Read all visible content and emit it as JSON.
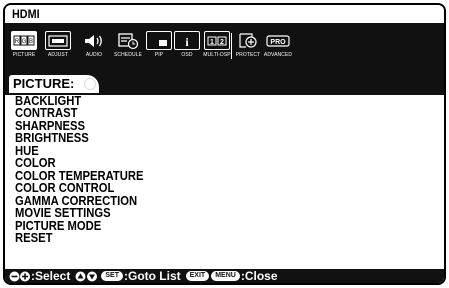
{
  "header": {
    "title": "HDMI"
  },
  "tabs": [
    {
      "label": "PICTURE",
      "icon": "picture-rgb-icon",
      "active": true
    },
    {
      "label": "ADJUST",
      "icon": "adjust-icon"
    },
    {
      "label": "AUDIO",
      "icon": "speaker-icon"
    },
    {
      "label": "SCHEDULE",
      "icon": "schedule-icon"
    },
    {
      "label": "PIP",
      "icon": "pip-icon"
    },
    {
      "label": "OSD",
      "icon": "info-icon"
    },
    {
      "label": "MULTI-DSP",
      "icon": "multi-display-icon"
    },
    {
      "label": "PROTECT",
      "icon": "protect-icon"
    },
    {
      "label": "ADVANCED",
      "icon": "pro-icon"
    }
  ],
  "icon_text": {
    "rgb": [
      "R",
      "G",
      "B"
    ],
    "osd": "i",
    "multi": [
      "1",
      "2"
    ],
    "pro": "PRO"
  },
  "section": {
    "title": "PICTURE:"
  },
  "menu_items": [
    "BACKLIGHT",
    "CONTRAST",
    "SHARPNESS",
    "BRIGHTNESS",
    "HUE",
    "COLOR",
    "COLOR TEMPERATURE",
    "COLOR CONTROL",
    "GAMMA CORRECTION",
    "MOVIE SETTINGS",
    "PICTURE MODE",
    "RESET"
  ],
  "footer": {
    "select_label": ":Select",
    "set_button": "SET",
    "goto_label": ":Goto List",
    "exit_button": "EXIT",
    "menu_button": "MENU",
    "close_label": ":Close"
  }
}
